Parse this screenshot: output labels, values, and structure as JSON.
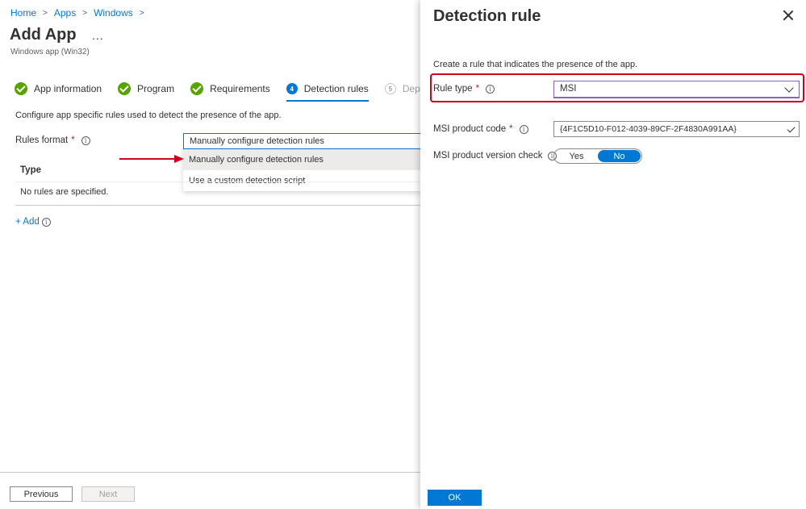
{
  "breadcrumb": {
    "items": [
      "Home",
      "Apps",
      "Windows"
    ]
  },
  "page": {
    "title": "Add App",
    "more": "...",
    "subtitle": "Windows app (Win32)"
  },
  "steps": [
    {
      "label": "App information",
      "status": "done"
    },
    {
      "label": "Program",
      "status": "done"
    },
    {
      "label": "Requirements",
      "status": "done"
    },
    {
      "label": "Detection rules",
      "number": "4",
      "status": "active"
    },
    {
      "label": "Depe",
      "number": "5",
      "status": "pending"
    }
  ],
  "main": {
    "description": "Configure app specific rules used to detect the presence of the app.",
    "rules_format": {
      "label": "Rules format",
      "required": "*",
      "info": "i",
      "value": "Manually configure detection rules",
      "options": [
        "Manually configure detection rules",
        "Use a custom detection script"
      ]
    },
    "table": {
      "column": "Type",
      "empty": "No rules are specified."
    },
    "add_label": "+ Add"
  },
  "footer": {
    "previous": "Previous",
    "next": "Next"
  },
  "panel": {
    "title": "Detection rule",
    "description": "Create a rule that indicates the presence of the app.",
    "rule_type": {
      "label": "Rule type",
      "required": "*",
      "info": "i",
      "value": "MSI"
    },
    "product_code": {
      "label": "MSI product code",
      "required": "*",
      "info": "i",
      "value": "{4F1C5D10-F012-4039-89CF-2F4830A991AA}"
    },
    "version_check": {
      "label": "MSI product version check",
      "info": "i",
      "options": [
        "Yes",
        "No"
      ],
      "selected": "No"
    },
    "ok": "OK"
  },
  "colors": {
    "accent": "#0078d4",
    "success": "#57a300",
    "highlight": "#d0021b",
    "required": "#a4262c"
  }
}
